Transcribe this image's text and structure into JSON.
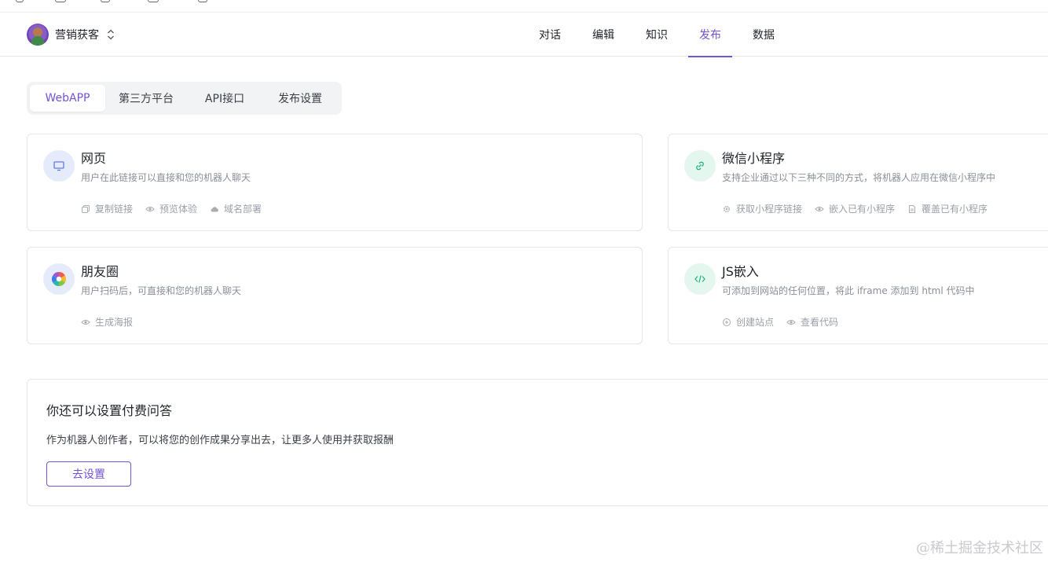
{
  "header": {
    "app_name": "营销获客",
    "nav": [
      {
        "label": "对话",
        "active": false
      },
      {
        "label": "编辑",
        "active": false
      },
      {
        "label": "知识",
        "active": false
      },
      {
        "label": "发布",
        "active": true
      },
      {
        "label": "数据",
        "active": false
      }
    ]
  },
  "tabs": [
    {
      "label": "WebAPP",
      "active": true
    },
    {
      "label": "第三方平台",
      "active": false
    },
    {
      "label": "API接口",
      "active": false
    },
    {
      "label": "发布设置",
      "active": false
    }
  ],
  "cards": {
    "webpage": {
      "title": "网页",
      "desc": "用户在此链接可以直接和您的机器人聊天",
      "icon": "monitor-icon",
      "actions": [
        "复制链接",
        "预览体验",
        "域名部署"
      ]
    },
    "miniprogram": {
      "title": "微信小程序",
      "desc": "支持企业通过以下三种不同的方式，将机器人应用在微信小程序中",
      "icon": "link-icon",
      "actions": [
        "获取小程序链接",
        "嵌入已有小程序",
        "覆盖已有小程序"
      ]
    },
    "moments": {
      "title": "朋友圈",
      "desc": "用户扫码后，可直接和您的机器人聊天",
      "icon": "aperture-icon",
      "actions": [
        "生成海报"
      ]
    },
    "jsembed": {
      "title": "JS嵌入",
      "desc": "可添加到网站的任何位置，将此 iframe 添加到 html 代码中",
      "icon": "code-icon",
      "actions": [
        "创建站点",
        "查看代码"
      ]
    }
  },
  "paid_qa": {
    "title": "你还可以设置付费问答",
    "desc": "作为机器人创作者，可以将您的创作成果分享出去，让更多人使用并获取报酬",
    "button": "去设置"
  },
  "watermark": "@稀土掘金技术社区",
  "colors": {
    "accent": "#7551d6",
    "border": "#e3e5e8",
    "muted": "#9ba0a8"
  }
}
